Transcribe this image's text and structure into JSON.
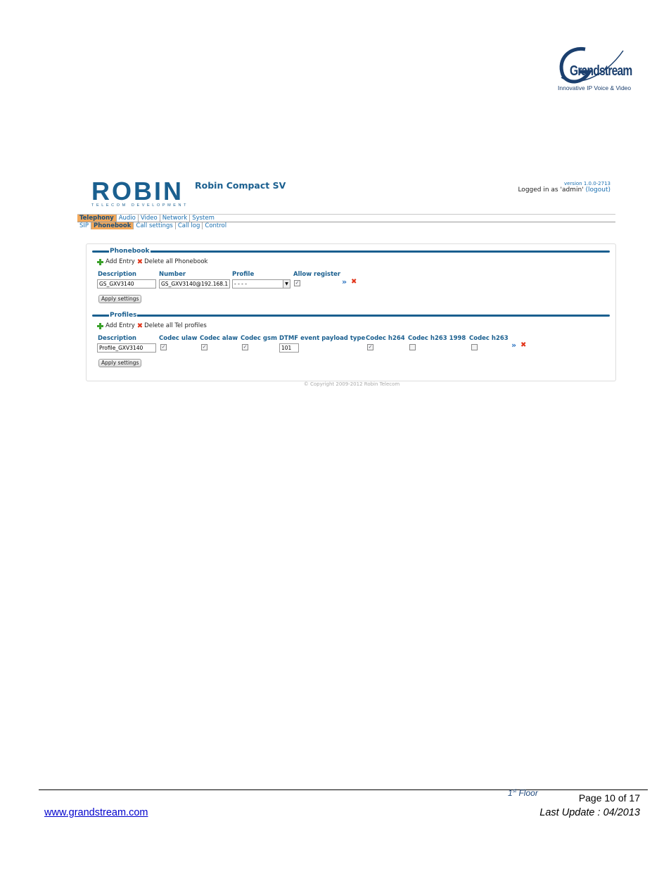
{
  "doc_logo": {
    "brand": "Grandstream",
    "tagline": "Innovative IP Voice & Video",
    "initial": "G"
  },
  "app": {
    "logo_big": "ROBIN",
    "logo_small": "TELECOM DEVELOPMENT",
    "title": "Robin Compact SV",
    "version": "version 1.0.0-2713",
    "logged_prefix": "Logged in as 'admin'",
    "logout": "(logout)"
  },
  "nav_main": [
    "Telephony",
    "Audio",
    "Video",
    "Network",
    "System"
  ],
  "nav_main_active": "Telephony",
  "nav_sub": [
    "SIP",
    "Phonebook",
    "Call settings",
    "Call log",
    "Control"
  ],
  "nav_sub_active": "Phonebook",
  "phonebook": {
    "title": "Phonebook",
    "add": "Add Entry",
    "delete": "Delete all Phonebook",
    "headers": {
      "description": "Description",
      "number": "Number",
      "profile": "Profile",
      "allow": "Allow register"
    },
    "row": {
      "description": "GS_GXV3140",
      "number": "GS_GXV3140@192.168.1",
      "profile": "- - - -",
      "allow": true
    },
    "apply": "Apply settings"
  },
  "profiles": {
    "title": "Profiles",
    "add": "Add Entry",
    "delete": "Delete all Tel profiles",
    "headers": {
      "description": "Description",
      "ulaw": "Codec ulaw",
      "alaw": "Codec alaw",
      "gsm": "Codec gsm",
      "dtmf": "DTMF event payload type",
      "h264": "Codec h264",
      "h263_1998": "Codec h263 1998",
      "h263": "Codec h263"
    },
    "row": {
      "description": "Profile_GXV3140",
      "ulaw": true,
      "alaw": true,
      "gsm": true,
      "dtmf": "101",
      "h264": true,
      "h263_1998": false,
      "h263": false
    },
    "apply": "Apply settings"
  },
  "copyright": "© Copyright 2009-2012 Robin Telecom",
  "footer": {
    "floor_num": "1",
    "floor_sup": "st",
    "floor_word": " Floor",
    "page": "Page 10 of 17",
    "website": "www.grandstream.com",
    "last_update": "Last Update : 04/2013"
  },
  "icons": {
    "add": "plus-icon",
    "delete": "delete-icon",
    "edit": "double-chevron-icon",
    "remove": "x-icon"
  },
  "colors": {
    "accent": "#1a5f8f",
    "nav_active": "#f2a85a",
    "link": "#1a6fb0",
    "delete": "#e2351a",
    "add": "#3aa12a"
  }
}
